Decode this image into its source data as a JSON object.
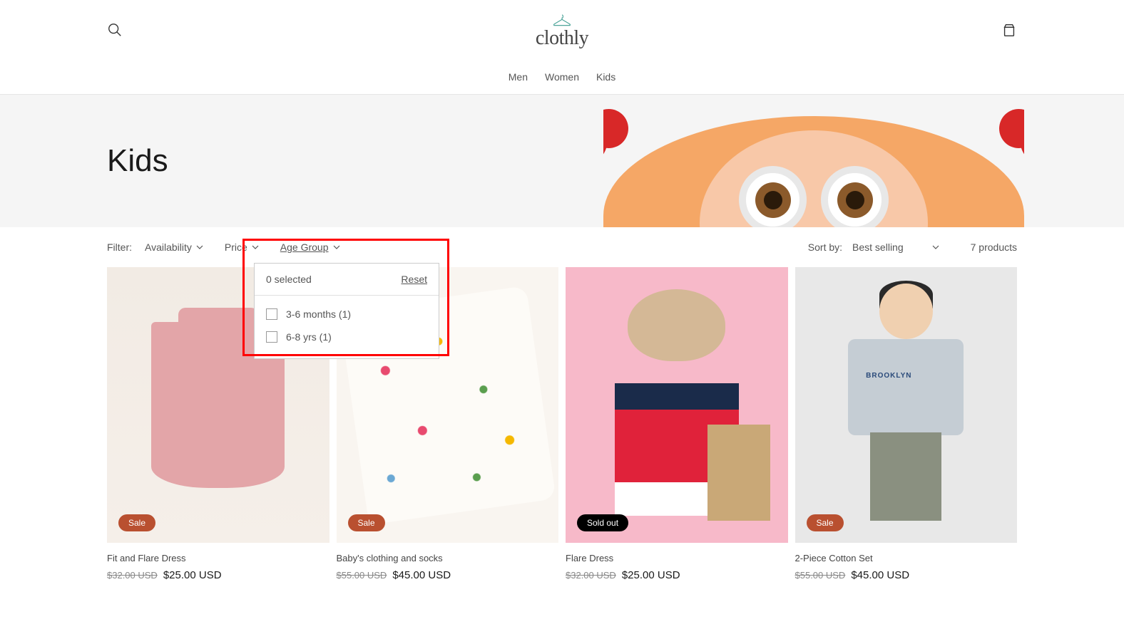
{
  "brand": "clothly",
  "nav": {
    "men": "Men",
    "women": "Women",
    "kids": "Kids"
  },
  "hero": {
    "title": "Kids"
  },
  "filters": {
    "label": "Filter:",
    "availability": "Availability",
    "price": "Price",
    "ageGroup": "Age Group",
    "dropdown": {
      "selectedText": "0 selected",
      "reset": "Reset",
      "options": [
        {
          "label": "3-6 months (1)"
        },
        {
          "label": "6-8 yrs (1)"
        }
      ]
    }
  },
  "sort": {
    "label": "Sort by:",
    "selected": "Best selling"
  },
  "productCount": "7 products",
  "products": [
    {
      "badge": "Sale",
      "badgeType": "sale",
      "title": "Fit and Flare Dress",
      "oldPrice": "$32.00 USD",
      "newPrice": "$25.00 USD"
    },
    {
      "badge": "Sale",
      "badgeType": "sale",
      "title": "Baby's clothing and socks",
      "oldPrice": "$55.00 USD",
      "newPrice": "$45.00 USD"
    },
    {
      "badge": "Sold out",
      "badgeType": "soldout",
      "title": "Flare Dress",
      "oldPrice": "$32.00 USD",
      "newPrice": "$25.00 USD"
    },
    {
      "badge": "Sale",
      "badgeType": "sale",
      "title": "2-Piece Cotton Set",
      "oldPrice": "$55.00 USD",
      "newPrice": "$45.00 USD"
    }
  ],
  "boySweaterText": "BROOKLYN"
}
